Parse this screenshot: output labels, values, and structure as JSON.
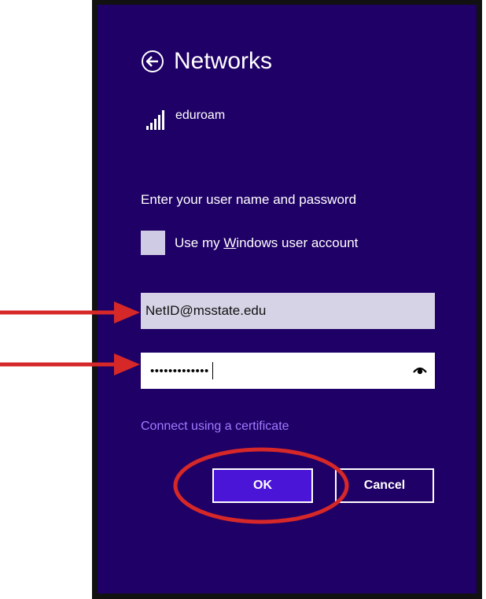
{
  "header": {
    "title": "Networks",
    "back_icon": "back-arrow-circle-icon"
  },
  "network": {
    "name": "eduroam",
    "signal_icon": "signal-strength-icon"
  },
  "form": {
    "prompt": "Enter your user name and password",
    "checkbox_label_prefix": "Use my ",
    "checkbox_label_underlined": "W",
    "checkbox_label_suffix": "indows user account",
    "username_value": "NetID@msstate.edu",
    "password_masked": "•••••••••••••",
    "reveal_icon": "eye-reveal-icon",
    "certificate_link": "Connect using a certificate"
  },
  "buttons": {
    "ok_label": "OK",
    "cancel_label": "Cancel"
  },
  "colors": {
    "panel_bg": "#1f0066",
    "ok_bg": "#4b15d8",
    "link": "#a07cff",
    "annotation": "#d62828"
  },
  "annotations": {
    "arrow_icon": "red-arrow-icon",
    "highlight_icon": "red-ellipse-highlight-icon"
  }
}
